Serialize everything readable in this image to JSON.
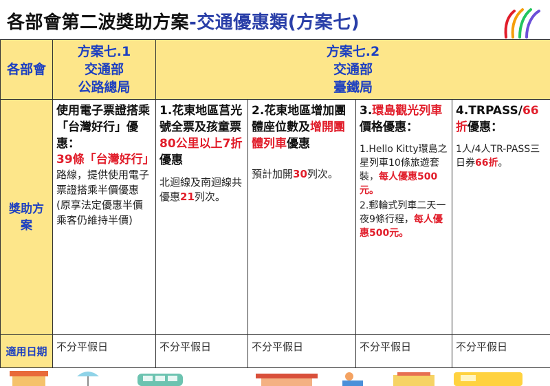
{
  "title": {
    "part1": "各部會第二波獎助方案",
    "part2": "-交通優惠類(方案七)"
  },
  "header": {
    "ministry_label": "各部會",
    "plan71": {
      "line1": "方案七.1",
      "line2": "交通部",
      "line3": "公路總局"
    },
    "plan72": {
      "line1": "方案七.2",
      "line2": "交通部",
      "line3": "臺鐵局"
    }
  },
  "row_labels": {
    "reward": "獎助方案",
    "date": "適用日期"
  },
  "cells": {
    "c1": {
      "head1": "使用電子票證搭乘「台灣好行」優惠：",
      "red1": "39條「台灣好行」",
      "body": "路線，提供使用電子票證搭乘半價優惠(原享法定優惠半價乘客仍維持半價)"
    },
    "c2": {
      "head1": "1.花東地區莒光號全票及孩童票",
      "red1": "80公里以上7折",
      "head2": "優惠",
      "body1": "北迴線及南迴線共優惠",
      "red2": "21",
      "body2": "列次。"
    },
    "c3": {
      "head1": "2.花東地區增加團體座位數及",
      "red1": "增開團體列車",
      "head2": "優惠",
      "body1": "預計加開",
      "red2": "30",
      "body2": "列次。"
    },
    "c4": {
      "head1": "3.",
      "red1": "環島觀光列車",
      "head2": "價格優惠：",
      "body1": "1.Hello Kitty環島之星列車10條旅遊套裝，",
      "red2": "每人優惠500元。",
      "body2": "2.郵輪式列車二天一夜9條行程，",
      "red3": "每人優惠500元。"
    },
    "c5": {
      "head1": "4.TRPASS/",
      "red1": "66折",
      "head2": "優惠：",
      "body1": "1人/4人TR-PASS三日券",
      "red2": "66折",
      "body2": "。"
    }
  },
  "dates": [
    "不分平假日",
    "不分平假日",
    "不分平假日",
    "不分平假日",
    "不分平假日"
  ],
  "colors": {
    "header_bg": "#fde68a",
    "header_text": "#1e40c0",
    "highlight": "#e11d2a"
  }
}
